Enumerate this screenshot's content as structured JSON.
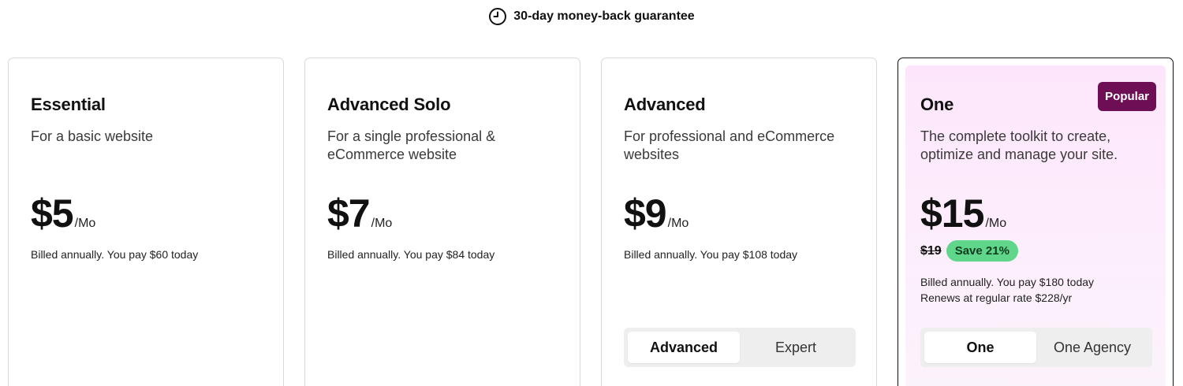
{
  "guarantee": {
    "icon": "clock-icon",
    "text": "30-day money-back guarantee"
  },
  "plans": [
    {
      "name": "Essential",
      "description": "For a basic website",
      "price": "$5",
      "period": "/Mo",
      "billed": "Billed annually. You pay $60 today"
    },
    {
      "name": "Advanced Solo",
      "description": "For a single professional & eCommerce website",
      "price": "$7",
      "period": "/Mo",
      "billed": "Billed annually. You pay $84 today"
    },
    {
      "name": "Advanced",
      "description": "For professional and eCommerce websites",
      "price": "$9",
      "period": "/Mo",
      "billed": "Billed annually. You pay $108 today",
      "toggle": {
        "options": [
          "Advanced",
          "Expert"
        ],
        "selected": "Advanced"
      }
    },
    {
      "name": "One",
      "badge": "Popular",
      "description": "The complete toolkit to create, optimize and manage your site.",
      "price": "$15",
      "period": "/Mo",
      "old_price": "$19",
      "save": "Save 21%",
      "billed": "Billed annually. You pay $180 today",
      "renews": "Renews at regular rate $228/yr",
      "toggle": {
        "options": [
          "One",
          "One Agency"
        ],
        "selected": "One"
      }
    }
  ],
  "colors": {
    "popular_badge_bg": "#6e0f56",
    "save_badge_bg": "#5fd68a",
    "featured_bg": "#fde6fb"
  }
}
